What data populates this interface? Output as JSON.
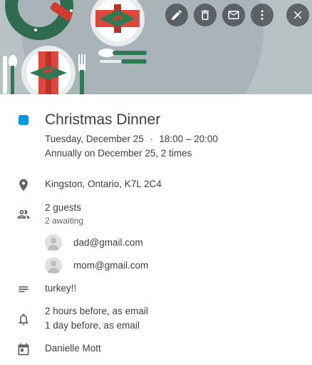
{
  "event": {
    "title": "Christmas Dinner",
    "date": "Tuesday, December 25",
    "separator": "·",
    "time": "18:00 – 20:00",
    "recurrence": "Annually on December 25, 2 times",
    "color": "#039be5"
  },
  "toolbar": {
    "icons": [
      "pencil-icon",
      "trash-icon",
      "envelope-icon",
      "more-vert-icon",
      "close-icon"
    ]
  },
  "location": {
    "icon": "location-pin-icon",
    "text": "Kingston, Ontario, K7L 2C4"
  },
  "guests": {
    "icon": "people-icon",
    "count": "2 guests",
    "status": "2 awaiting",
    "list": [
      {
        "email": "dad@gmail.com"
      },
      {
        "email": "mom@gmail.com"
      }
    ]
  },
  "description": {
    "icon": "notes-icon",
    "text": "turkey!!"
  },
  "notifications": {
    "icon": "bell-icon",
    "items": [
      "2 hours before, as email",
      "1 day before, as email"
    ]
  },
  "calendar": {
    "icon": "calendar-icon",
    "owner": "Danielle Mott"
  }
}
